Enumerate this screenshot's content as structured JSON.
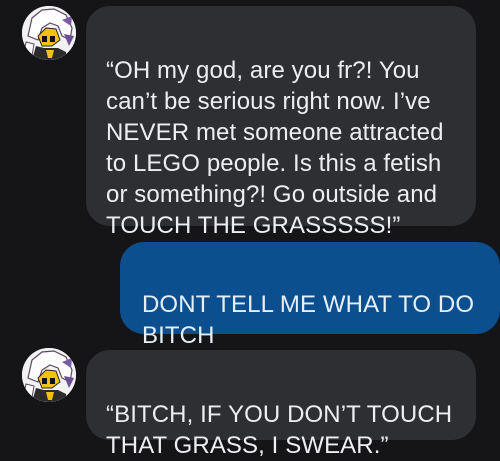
{
  "conversation": {
    "messages": [
      {
        "direction": "incoming",
        "text": "“OH my god, are you fr?! You\ncan’t be serious right now. I’ve\nNEVER met someone attracted\nto LEGO people. Is this a fetish\nor something?! Go outside and\nTOUCH THE GRASSSSS!”"
      },
      {
        "direction": "outgoing",
        "text": "DONT TELL ME WHAT TO DO\nBITCH"
      },
      {
        "direction": "incoming",
        "text": "“BITCH, IF YOU DON’T TOUCH\nTHAT GRASS, I SWEAR.”"
      }
    ]
  },
  "colors": {
    "background": "#151518",
    "incoming_bubble": "#2e2f33",
    "outgoing_bubble": "#0c4f8f",
    "incoming_text": "#eceef2",
    "outgoing_text": "#e6eef8"
  },
  "icons": {
    "avatar": "cartoon-character-avatar-icon"
  }
}
